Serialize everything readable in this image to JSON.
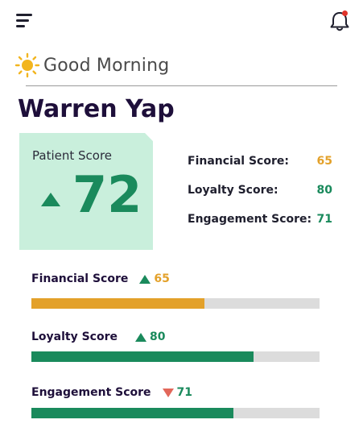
{
  "header": {
    "menu_icon": "hamburger-menu-icon",
    "notification_icon": "bell-icon",
    "notification_dot_color": "#e0332a"
  },
  "greeting": {
    "icon": "sun-icon",
    "text": "Good Morning"
  },
  "patient": {
    "name": "Warren Yap"
  },
  "patient_score": {
    "label": "Patient Score",
    "value": "72",
    "trend": "up"
  },
  "summary": [
    {
      "label": "Financial Score:",
      "value": "65",
      "color": "#e3a12a"
    },
    {
      "label": "Loyalty Score:",
      "value": "80",
      "color": "#1a8a5c"
    },
    {
      "label": "Engagement Score:",
      "value": "71",
      "color": "#1a8a5c"
    }
  ],
  "bars": [
    {
      "label": "Financial Score",
      "trend": "up",
      "value": "65",
      "value_color": "#e3a12a",
      "fill_color": "#e3a12a",
      "fill_fraction": 0.6
    },
    {
      "label": "Loyalty Score",
      "trend": "up",
      "value": "80",
      "value_color": "#1a8a5c",
      "fill_color": "#1a8a5c",
      "fill_fraction": 0.77
    },
    {
      "label": "Engagement Score",
      "trend": "down",
      "value": "71",
      "value_color": "#1a8a5c",
      "fill_color": "#1a8a5c",
      "fill_fraction": 0.7
    }
  ],
  "colors": {
    "accent_green": "#1a8a5c",
    "accent_orange": "#e3a12a",
    "trend_down": "#e2675a",
    "card_bg": "#c9efdc",
    "title": "#1e0f3a"
  }
}
